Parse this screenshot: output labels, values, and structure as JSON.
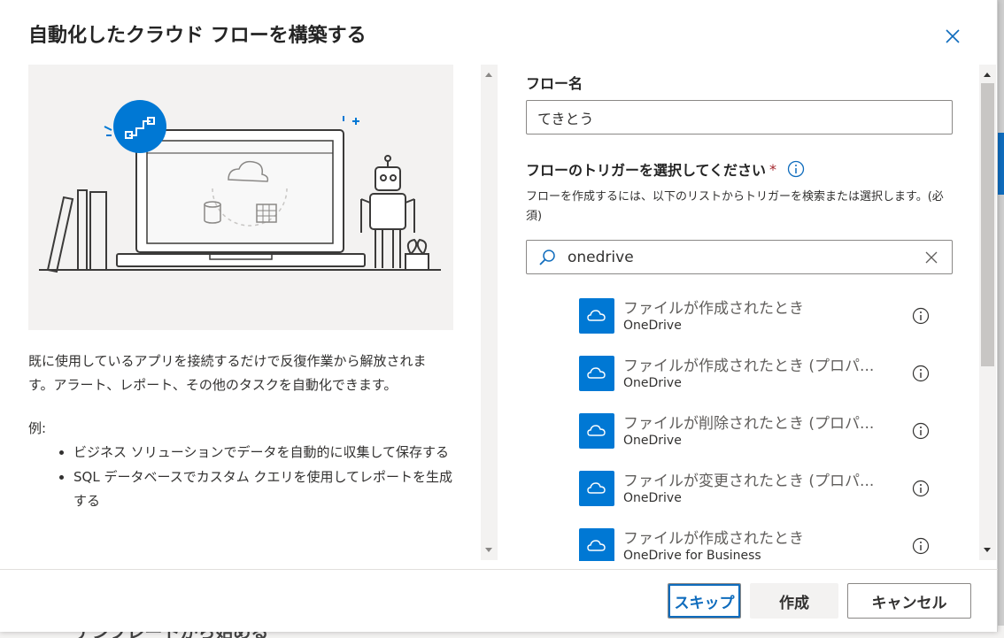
{
  "dialog": {
    "title": "自動化したクラウド フローを構築する"
  },
  "left": {
    "description": "既に使用しているアプリを接続するだけで反復作業から解放されます。アラート、レポート、その他のタスクを自動化できます。",
    "example_label": "例:",
    "examples": [
      "ビジネス ソリューションでデータを自動的に収集して保存する",
      "SQL データベースでカスタム クエリを使用してレポートを生成する"
    ]
  },
  "form": {
    "flow_name_label": "フロー名",
    "flow_name_value": "てきとう",
    "trigger_label": "フローのトリガーを選択してください",
    "required_mark": "*",
    "help_text": "フローを作成するには、以下のリストからトリガーを検索または選択します。(必須)",
    "search_value": "onedrive"
  },
  "triggers": [
    {
      "title": "ファイルが作成されたとき",
      "connector": "OneDrive"
    },
    {
      "title": "ファイルが作成されたとき (プロパ...",
      "connector": "OneDrive"
    },
    {
      "title": "ファイルが削除されたとき (プロパ...",
      "connector": "OneDrive"
    },
    {
      "title": "ファイルが変更されたとき (プロパ...",
      "connector": "OneDrive"
    },
    {
      "title": "ファイルが作成されたとき",
      "connector": "OneDrive for Business"
    }
  ],
  "footer": {
    "skip_label": "スキップ",
    "create_label": "作成",
    "cancel_label": "キャンセル"
  },
  "background": {
    "partial_text": "テンプレートから始める"
  },
  "icons": [
    "close-icon",
    "info-icon",
    "search-icon",
    "clear-icon",
    "onedrive-cloud-icon",
    "flow-icon"
  ],
  "colors": {
    "accent": "#0f6cbd",
    "onedrive_tile": "#0078d4",
    "required": "#a4262c",
    "panel_bg": "#f3f2f1"
  }
}
